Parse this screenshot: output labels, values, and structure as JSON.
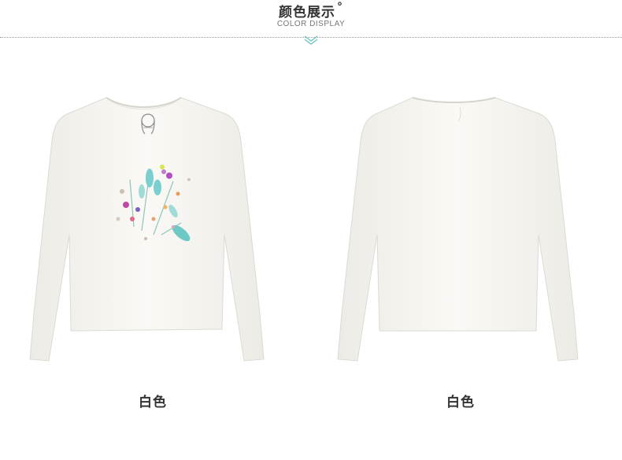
{
  "header": {
    "title": "颜色展示",
    "title_mark": "°",
    "subtitle": "COLOR DISPLAY",
    "accent_color": "#6fc1c4",
    "divider_icon": "chevron-down-double-icon"
  },
  "products": [
    {
      "view": "front",
      "caption": "白色",
      "color": "#f7f6f2",
      "print": "floral embroidery"
    },
    {
      "view": "back",
      "caption": "白色",
      "color": "#f7f6f2"
    }
  ]
}
